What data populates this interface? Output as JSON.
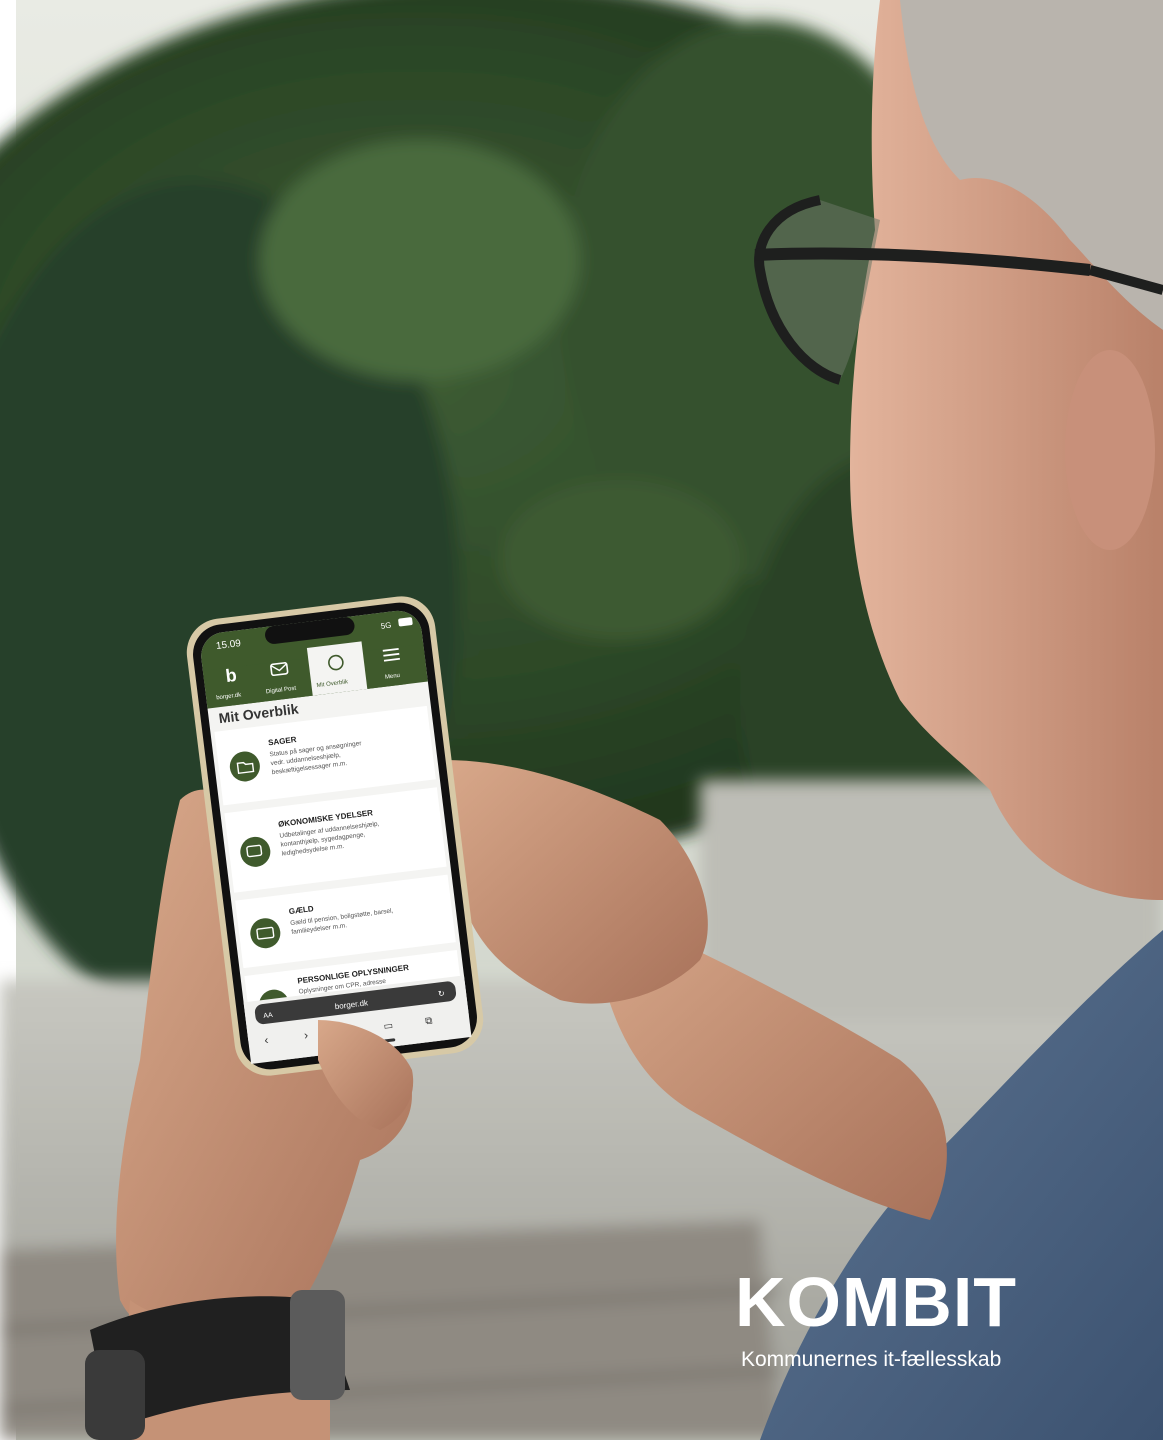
{
  "phone": {
    "status_time": "15.09",
    "status_net": "5G",
    "nav": [
      {
        "label": "borger.dk"
      },
      {
        "label": "Digital Post"
      },
      {
        "label": "Mit Overblik"
      },
      {
        "label": "Menu"
      }
    ],
    "page_title": "Mit Overblik",
    "cards": [
      {
        "title": "SAGER",
        "lines": [
          "Status på sager og ansøgninger",
          "vedr. uddannelseshjælp,",
          "beskæftigelsessager m.m."
        ]
      },
      {
        "title": "ØKONOMISKE YDELSER",
        "lines": [
          "Udbetalinger af uddannelseshjælp,",
          "kontanthjælp, sygedagpenge,",
          "ledighedsydelse m.m."
        ]
      },
      {
        "title": "GÆLD",
        "lines": [
          "Gæld til pension, boligstøtte, barsel,",
          "familieydelser m.m."
        ]
      },
      {
        "title": "PERSONLIGE OPLYSNINGER",
        "lines": [
          "Oplysninger om CPR, adresse"
        ]
      }
    ],
    "url": "borger.dk",
    "aa": "AA"
  },
  "logo": {
    "word": "KOMBIT",
    "tagline": "Kommunernes it-fællesskab"
  },
  "colors": {
    "brand_green": "#3f5a2c",
    "foliage": "#2f4a2a",
    "ground": "#b9b9b2"
  }
}
